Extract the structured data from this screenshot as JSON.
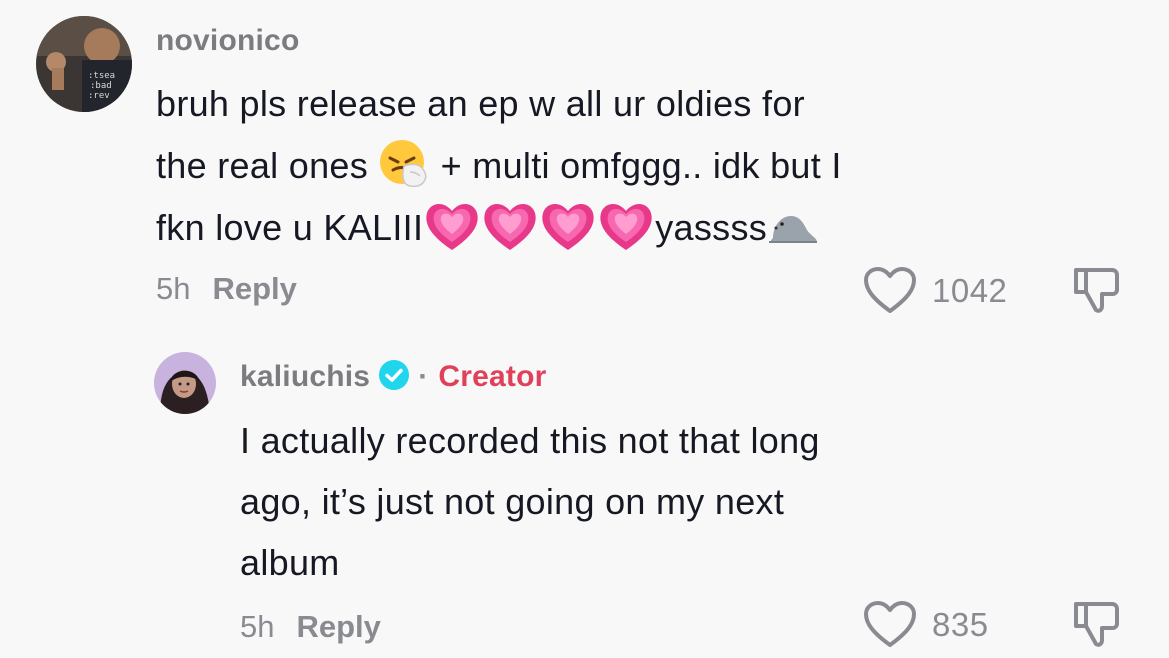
{
  "comments": [
    {
      "username": "novionico",
      "avatar_icon": "user-avatar-photo",
      "lines": [
        {
          "text": "bruh pls release an ep w all ur oldies for"
        },
        {
          "text_a": "the real ones ",
          "emoji": "sneezing-face-emoji",
          "text_b": " + multi omfggg.. idk but I"
        },
        {
          "text_a": "fkn love u KALIII",
          "emoji": "growing-heart-emoji x4",
          "text_b": "yassss",
          "emoji_b": "seal-emoji"
        }
      ],
      "time": "5h",
      "reply_label": "Reply",
      "likes": "1042"
    },
    {
      "username": "kaliuchis",
      "avatar_icon": "user-avatar-photo",
      "verified_icon": "verified-badge-icon",
      "separator": "·",
      "badge": "Creator",
      "lines": [
        {
          "text": "I actually recorded this not that long"
        },
        {
          "text": "ago, it’s just not going on my next"
        },
        {
          "text": "album"
        }
      ],
      "time": "5h",
      "reply_label": "Reply",
      "likes": "835"
    }
  ],
  "colors": {
    "background": "#f8f8f8",
    "text": "#161823",
    "muted": "#8a8b91",
    "creator": "#e1405b",
    "verified": "#20d5ec"
  }
}
